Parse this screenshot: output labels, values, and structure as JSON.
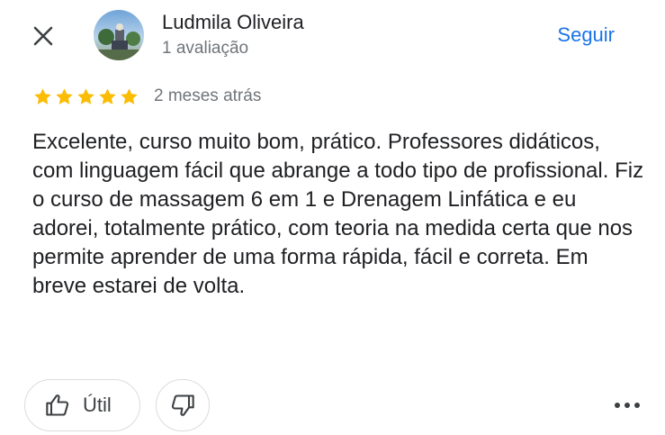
{
  "header": {
    "close_icon": "close-icon",
    "reviewer_name": "Ludmila Oliveira",
    "reviews_count": "1 avaliação",
    "follow_label": "Seguir",
    "accent_color": "#1a73e8"
  },
  "review": {
    "rating": 5,
    "max_rating": 5,
    "star_color": "#fbbc04",
    "date": "2 meses atrás",
    "text": "Excelente, curso muito bom, prático. Professores didáticos, com linguagem fácil que abrange a todo tipo de profissional. Fiz o curso de massagem 6 em 1 e Drenagem Linfática e eu adorei, totalmente prático, com teoria na medida certa que nos permite aprender de uma forma rápida, fácil e correta. Em breve estarei de volta."
  },
  "actions": {
    "helpful_label": "Útil",
    "helpful_icon": "thumbs-up-icon",
    "unhelpful_icon": "thumbs-down-icon",
    "more_icon": "more-horizontal-icon"
  }
}
